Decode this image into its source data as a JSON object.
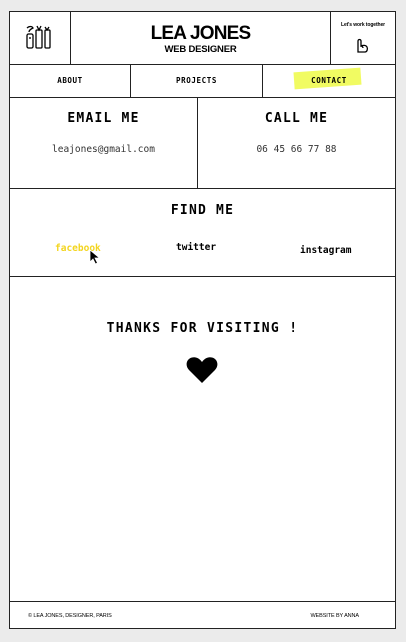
{
  "header": {
    "brand_name": "LEA JONES",
    "brand_role": "WEB DESIGNER",
    "work_together": "Let's work together"
  },
  "nav": {
    "about": "ABOUT",
    "projects": "PROJECTS",
    "contact": "CONTACT"
  },
  "contact": {
    "email_title": "EMAIL ME",
    "email_value": "leajones@gmail.com",
    "call_title": "CALL ME",
    "call_value": "06 45 66 77 88"
  },
  "find": {
    "title": "FIND ME",
    "facebook": "facebook",
    "twitter": "twitter",
    "instagram": "instagram"
  },
  "thanks": {
    "text": "THANKS FOR VISITING !"
  },
  "footer": {
    "left": "© LEA JONES, DESIGNER, PARIS",
    "right": "WEBSITE BY ANNA"
  },
  "colors": {
    "highlight": "#f1fb62",
    "facebook_hover": "#f3d51f",
    "border": "#222222"
  },
  "icons": {
    "logo": "design-tools-icon",
    "arm": "flexed-arm-icon",
    "cursor": "mouse-pointer-icon",
    "heart": "heart-icon"
  }
}
